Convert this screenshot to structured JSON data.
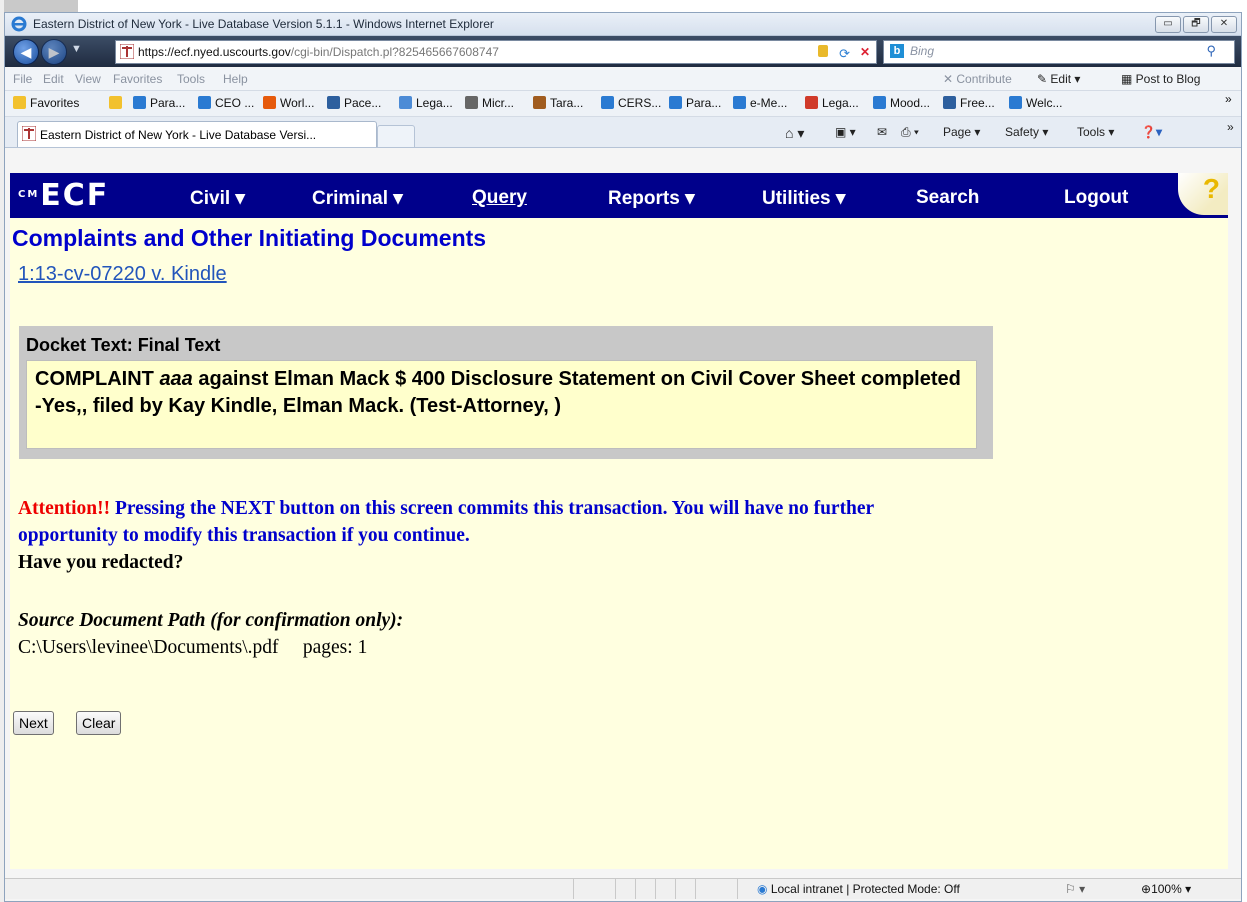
{
  "browser": {
    "title": "Eastern District of New York - Live Database Version 5.1.1 - Windows Internet Explorer",
    "url_host": "https://ecf.nyed.uscourts.gov",
    "url_path": "/cgi-bin/Dispatch.pl?825465667608747",
    "search_placeholder": "Bing",
    "menu": [
      "File",
      "Edit",
      "View",
      "Favorites",
      "Tools",
      "Help"
    ],
    "menu_right": {
      "contribute": "Contribute",
      "edit": "Edit",
      "post": "Post to Blog"
    },
    "favorites_label": "Favorites",
    "favorites": [
      "Para...",
      "CEO ...",
      "Worl...",
      "Pace...",
      "Lega...",
      "Micr...",
      "Tara...",
      "CERS...",
      "Para...",
      "e-Me...",
      "Lega...",
      "Mood...",
      "Free...",
      "Welc..."
    ],
    "tab_title": "Eastern District of New York - Live Database Versi...",
    "commands": {
      "page": "Page",
      "safety": "Safety",
      "tools": "Tools"
    },
    "status": {
      "zone": "Local intranet | Protected Mode: Off",
      "zoom": "100%"
    },
    "window_buttons": {
      "minimize": "▭",
      "maximize": "🗗",
      "close": "✕"
    }
  },
  "ecf": {
    "logo": "ECF",
    "logo_small": "CM",
    "nav": [
      "Civil",
      "Criminal",
      "Query",
      "Reports",
      "Utilities",
      "Search",
      "Logout"
    ],
    "help": "?",
    "page_title": "Complaints and Other Initiating Documents",
    "case_link": "1:13-cv-07220 v. Kindle",
    "docket": {
      "header": "Docket Text: Final Text",
      "text_prefix": "COMPLAINT ",
      "text_italic": "aaa",
      "text_rest": " against Elman Mack $ 400 Disclosure Statement on Civil Cover Sheet completed -Yes,, filed by Kay Kindle, Elman Mack. (Test-Attorney, )"
    },
    "attention_label": "Attention!!",
    "attention_text": " Pressing the NEXT button on this screen commits this transaction. You will have no further opportunity to modify this transaction if you continue.",
    "redacted_question": "Have you redacted?",
    "source_label": "Source Document Path (for confirmation only):",
    "source_path": "C:\\Users\\levinee\\Documents\\.pdf",
    "pages": "pages: 1",
    "buttons": {
      "next": "Next",
      "clear": "Clear"
    }
  },
  "colors": {
    "ecf_bar": "#00008b",
    "page_bg": "#ffffe0",
    "title_blue": "#0000cc",
    "attention_red": "#ee0000"
  }
}
